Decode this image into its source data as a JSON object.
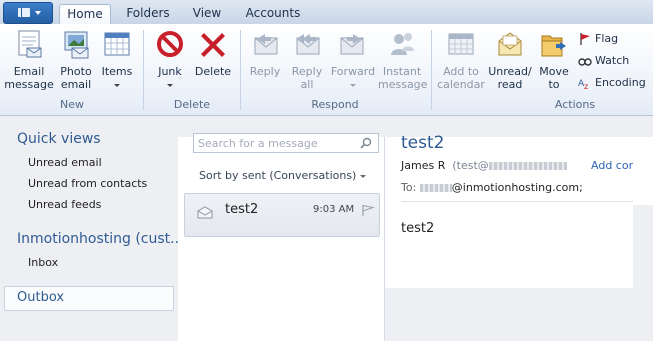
{
  "tabs": [
    {
      "label": "Home",
      "active": true
    },
    {
      "label": "Folders",
      "active": false
    },
    {
      "label": "View",
      "active": false
    },
    {
      "label": "Accounts",
      "active": false
    }
  ],
  "ribbon": {
    "new": {
      "group_label": "New",
      "email_message": "Email\nmessage",
      "photo_email": "Photo\nemail",
      "items": "Items"
    },
    "delete": {
      "group_label": "Delete",
      "junk": "Junk",
      "delete": "Delete"
    },
    "respond": {
      "group_label": "Respond",
      "reply": "Reply",
      "reply_all": "Reply\nall",
      "forward": "Forward",
      "instant_message": "Instant\nmessage"
    },
    "actions": {
      "group_label": "Actions",
      "add_to_calendar": "Add to\ncalendar",
      "unread_read": "Unread/\nread",
      "move_to": "Move\nto",
      "flag": "Flag",
      "watch": "Watch",
      "encoding": "Encoding"
    }
  },
  "folders": {
    "quick_views": {
      "label": "Quick views",
      "items": [
        "Unread email",
        "Unread from contacts",
        "Unread feeds"
      ]
    },
    "account": {
      "label": "Inmotionhosting (cust...",
      "items": [
        "Inbox"
      ]
    },
    "selected_folder": "Outbox"
  },
  "message_list": {
    "search_placeholder": "Search for a message",
    "sort_label": "Sort by sent (Conversations)",
    "messages": [
      {
        "subject": "test2",
        "time": "9:03 AM"
      }
    ]
  },
  "reading_pane": {
    "subject": "test2",
    "from_name": "James R",
    "from_addr_prefix": "(test@",
    "add_contact": "Add contact",
    "to_label": "To:",
    "to_addr": "@inmotionhosting.com;",
    "body": "test2"
  },
  "colors": {
    "accent_blue": "#2d5a93",
    "link_blue": "#2b66b4",
    "junk_red": "#c8202a"
  }
}
